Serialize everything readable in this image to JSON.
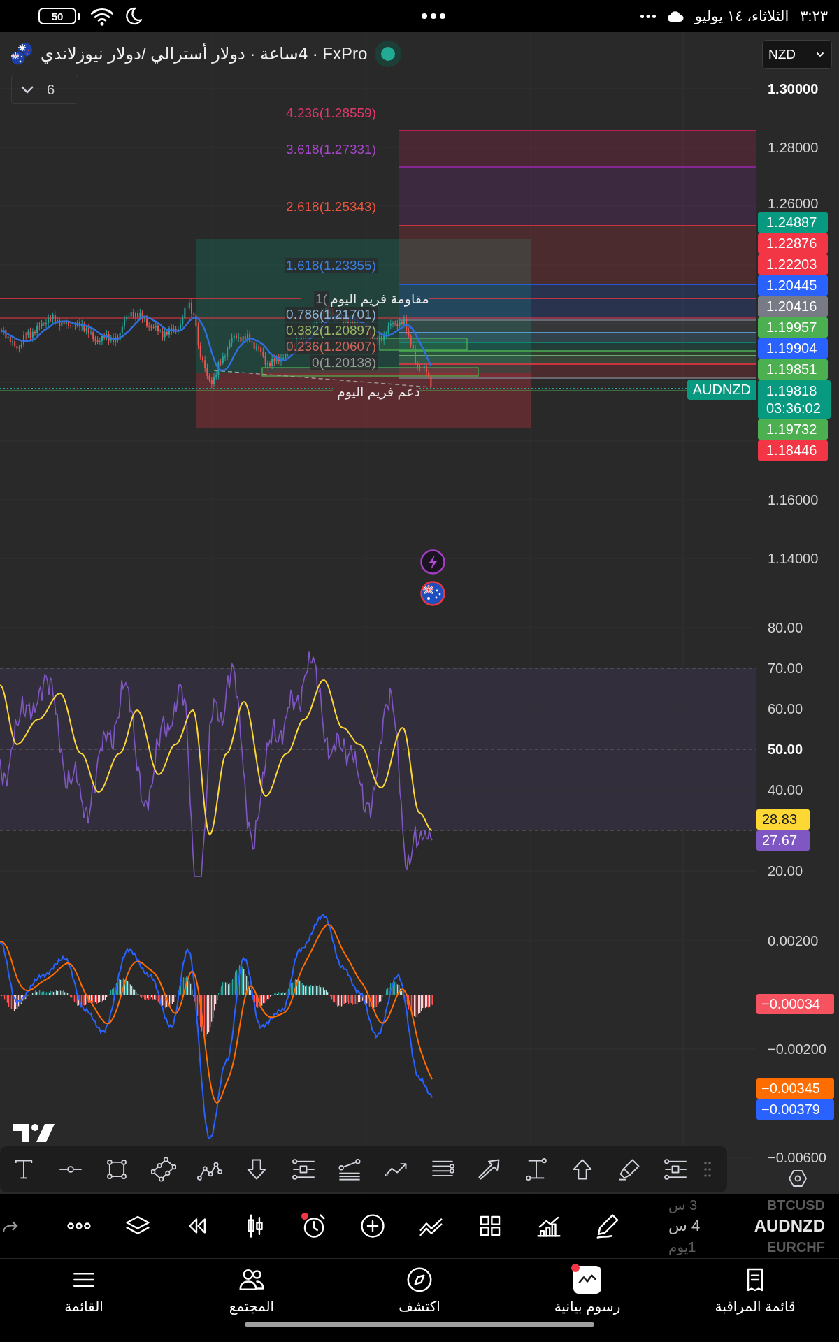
{
  "status_bar": {
    "battery": "50",
    "date": "الثلاثاء، ١٤ يوليو",
    "time": "٣:٢٣"
  },
  "header": {
    "title": "FxPro‏ · 4ساعة · دولار أسترالي /دولار نيوزلاندي",
    "market_open": true,
    "currency": "NZD",
    "indicator_count": "6"
  },
  "price_pane": {
    "axis_labels": [
      {
        "text": "1.30000",
        "bold": true
      },
      {
        "text": "1.28000",
        "bold": false
      },
      {
        "text": "1.26000",
        "bold": false
      },
      {
        "text": "1.16000",
        "bold": false
      },
      {
        "text": "1.14000",
        "bold": false
      }
    ],
    "fib_labels": [
      {
        "text": "4.236(1.28559)",
        "color": "#e0386a"
      },
      {
        "text": "3.618(1.27331)",
        "color": "#a646c8"
      },
      {
        "text": "2.618(1.25343)",
        "color": "#e8553e"
      },
      {
        "text": "1.618(1.23355)",
        "color": "#3d7fe0"
      },
      {
        "text": "1(",
        "color": "#8a8d96"
      },
      {
        "text": "0.786(1.21701)",
        "color": "#90b4d8"
      },
      {
        "text": "0.382(1.20897)",
        "color": "#9ab86a"
      },
      {
        "text": "0.236(1.20607)",
        "color": "#d0645a"
      },
      {
        "text": "0(1.20138)",
        "color": "#9a9a9a"
      }
    ],
    "annotations": [
      "مقاومة فريم اليوم",
      "دعم فريم اليوم"
    ],
    "symbol_tag": "AUDNZD",
    "price_tags": [
      {
        "kind": "level",
        "text": "1.24887",
        "color": "#089981"
      },
      {
        "kind": "level",
        "text": "1.22876",
        "color": "#f23645"
      },
      {
        "kind": "level",
        "text": "1.22203",
        "color": "#f23645"
      },
      {
        "kind": "level",
        "text": "1.20445",
        "color": "#2962ff"
      },
      {
        "kind": "level",
        "text": "1.20416",
        "color": "#787b86"
      },
      {
        "kind": "level",
        "text": "1.19957",
        "color": "#4caf50"
      },
      {
        "kind": "level",
        "text": "1.19904",
        "color": "#2962ff"
      },
      {
        "kind": "level",
        "text": "1.19851",
        "color": "#4caf50"
      },
      {
        "kind": "last",
        "text": "1.19818",
        "countdown": "03:36:02",
        "color": "#089981"
      },
      {
        "kind": "level",
        "text": "1.19732",
        "color": "#4caf50"
      },
      {
        "kind": "level",
        "text": "1.18446",
        "color": "#f23645"
      }
    ]
  },
  "rsi_pane": {
    "axis_labels": [
      {
        "text": "80.00",
        "bold": false
      },
      {
        "text": "70.00",
        "bold": false
      },
      {
        "text": "60.00",
        "bold": false
      },
      {
        "text": "50.00",
        "bold": true
      },
      {
        "text": "40.00",
        "bold": false
      },
      {
        "text": "20.00",
        "bold": false
      }
    ],
    "tags": [
      {
        "text": "28.83",
        "color": "#fdd835"
      },
      {
        "text": "27.67",
        "color": "#7e57c2"
      }
    ]
  },
  "macd_pane": {
    "axis_labels": [
      {
        "text": "0.00200",
        "bold": false
      },
      {
        "text": "−0.00200",
        "bold": false
      },
      {
        "text": "−0.00600",
        "bold": false
      }
    ],
    "tags": [
      {
        "text": "−0.00034",
        "color": "#f7525f"
      },
      {
        "text": "−0.00345",
        "color": "#ff6d00"
      },
      {
        "text": "−0.00379",
        "color": "#2962ff"
      }
    ]
  },
  "bottom_toolbar": {
    "alarm_badge": true,
    "symbols": [
      {
        "symbol": "BTCUSD",
        "interval": "3 س",
        "selected": false
      },
      {
        "symbol": "AUDNZD",
        "interval": "4 س",
        "selected": true
      },
      {
        "symbol": "EURCHF",
        "interval": "1يوم",
        "selected": false
      }
    ]
  },
  "nav": {
    "items": [
      {
        "label": "قائمة المراقبة",
        "selected": false,
        "badge": false
      },
      {
        "label": "رسوم بيانية",
        "selected": true,
        "badge": true
      },
      {
        "label": "اكتشف",
        "selected": false,
        "badge": false
      },
      {
        "label": "المجتمع",
        "selected": false,
        "badge": false
      },
      {
        "label": "القائمة",
        "selected": false,
        "badge": false
      }
    ]
  }
}
